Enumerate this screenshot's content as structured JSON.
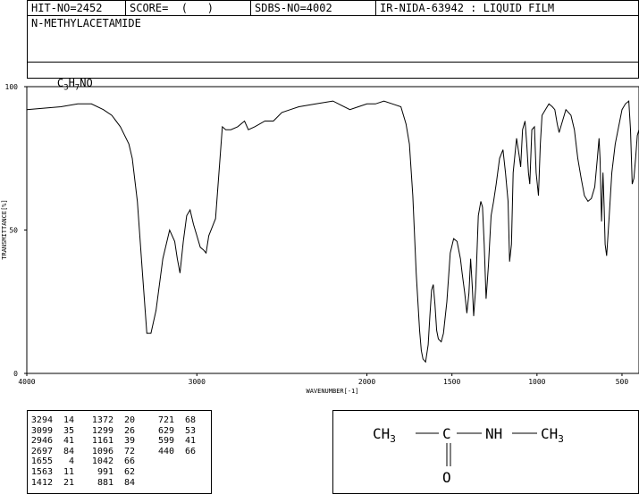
{
  "header": {
    "hit_no": "HIT-NO=2452",
    "score": "SCORE=  (   )",
    "sdbs_no": "SDBS-NO=4002",
    "ir_nida": "IR-NIDA-63942 : LIQUID FILM"
  },
  "compound": {
    "name": "N-METHYLACETAMIDE",
    "formula_c": "C",
    "formula_c_sub": "3",
    "formula_h": "H",
    "formula_h_sub": "7",
    "formula_rest": "NO"
  },
  "chart_data": {
    "type": "line",
    "xlabel": "WAVENUMBER[-1]",
    "ylabel": "TRANSMITTANCE[%]",
    "xlim": [
      4000,
      400
    ],
    "ylim": [
      0,
      100
    ],
    "x_ticks": [
      4000,
      3000,
      2000,
      1500,
      1000,
      500
    ],
    "y_ticks": [
      0,
      50,
      100
    ],
    "grid": false,
    "series": [
      {
        "x": [
          4000,
          3900,
          3800,
          3700,
          3620,
          3550,
          3500,
          3450,
          3400,
          3380,
          3350,
          3320,
          3294,
          3270,
          3240,
          3200,
          3160,
          3130,
          3115,
          3099,
          3080,
          3060,
          3040,
          3020,
          3000,
          2980,
          2960,
          2946,
          2930,
          2910,
          2890,
          2870,
          2850,
          2830,
          2800,
          2760,
          2720,
          2697,
          2660,
          2600,
          2550,
          2500,
          2450,
          2400,
          2300,
          2200,
          2100,
          2050,
          2000,
          1950,
          1900,
          1850,
          1800,
          1770,
          1750,
          1730,
          1710,
          1700,
          1690,
          1680,
          1670,
          1655,
          1640,
          1630,
          1620,
          1610,
          1600,
          1590,
          1580,
          1563,
          1550,
          1530,
          1510,
          1490,
          1470,
          1450,
          1440,
          1425,
          1412,
          1400,
          1390,
          1380,
          1372,
          1360,
          1345,
          1330,
          1320,
          1310,
          1299,
          1285,
          1270,
          1255,
          1240,
          1220,
          1200,
          1185,
          1170,
          1161,
          1150,
          1140,
          1120,
          1105,
          1096,
          1085,
          1070,
          1060,
          1050,
          1042,
          1030,
          1015,
          1005,
          991,
          980,
          970,
          950,
          930,
          910,
          895,
          881,
          870,
          850,
          830,
          800,
          780,
          760,
          740,
          721,
          700,
          680,
          660,
          645,
          635,
          629,
          620,
          612,
          605,
          599,
          590,
          575,
          560,
          540,
          520,
          500,
          480,
          460,
          450,
          440,
          430,
          420,
          410,
          400
        ],
        "y": [
          92,
          92.5,
          93,
          94,
          94,
          92,
          90,
          86,
          80,
          75,
          60,
          35,
          14,
          14,
          22,
          40,
          50,
          46,
          40,
          35,
          46,
          55,
          57,
          52,
          48,
          44,
          43,
          42,
          48,
          51,
          54,
          70,
          86,
          85,
          85,
          86,
          88,
          85,
          86,
          88,
          88,
          91,
          92,
          93,
          94,
          95,
          92,
          93,
          94,
          94,
          95,
          94,
          93,
          87,
          80,
          62,
          35,
          25,
          15,
          8,
          5,
          4,
          10,
          20,
          29,
          31,
          24,
          15,
          12,
          11,
          14,
          25,
          42,
          47,
          46,
          40,
          35,
          28,
          21,
          28,
          40,
          30,
          20,
          30,
          55,
          60,
          58,
          45,
          26,
          38,
          55,
          60,
          66,
          75,
          78,
          70,
          60,
          39,
          45,
          70,
          82,
          76,
          72,
          85,
          88,
          80,
          70,
          66,
          85,
          86,
          70,
          62,
          80,
          90,
          92,
          94,
          93,
          92,
          87,
          84,
          88,
          92,
          90,
          85,
          75,
          68,
          62,
          60,
          61,
          65,
          75,
          82,
          75,
          53,
          70,
          58,
          45,
          41,
          55,
          70,
          80,
          86,
          92,
          94,
          95,
          85,
          66,
          68,
          75,
          83,
          85
        ]
      }
    ]
  },
  "peaks": [
    {
      "wn": "3294",
      "t": "14"
    },
    {
      "wn": "3099",
      "t": "35"
    },
    {
      "wn": "2946",
      "t": "41"
    },
    {
      "wn": "2697",
      "t": "84"
    },
    {
      "wn": "1655",
      "t": "4"
    },
    {
      "wn": "1563",
      "t": "11"
    },
    {
      "wn": "1412",
      "t": "21"
    },
    {
      "wn": "1372",
      "t": "20"
    },
    {
      "wn": "1299",
      "t": "26"
    },
    {
      "wn": "1161",
      "t": "39"
    },
    {
      "wn": "1096",
      "t": "72"
    },
    {
      "wn": "1042",
      "t": "66"
    },
    {
      "wn": "991",
      "t": "62"
    },
    {
      "wn": "881",
      "t": "84"
    },
    {
      "wn": "721",
      "t": "68"
    },
    {
      "wn": "629",
      "t": "53"
    },
    {
      "wn": "599",
      "t": "41"
    },
    {
      "wn": "440",
      "t": "66"
    }
  ],
  "structure": {
    "left_group": "CH",
    "left_sub": "3",
    "center_atom": "C",
    "nh": "NH",
    "right_group": "CH",
    "right_sub": "3",
    "oxygen": "O"
  }
}
